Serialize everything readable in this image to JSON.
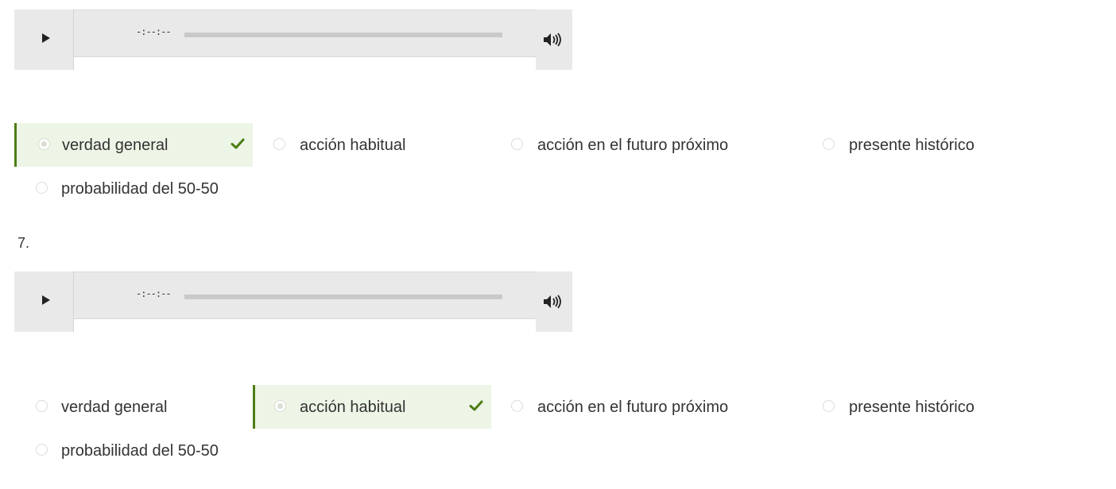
{
  "question_6": {
    "player": {
      "time": "-:--:--"
    },
    "options": [
      {
        "label": "verdad general"
      },
      {
        "label": "acción habitual"
      },
      {
        "label": "acción en el futuro próximo"
      },
      {
        "label": "presente histórico"
      },
      {
        "label": "probabilidad del 50-50"
      }
    ],
    "selected_option": "verdad general",
    "correct": true
  },
  "question_7": {
    "number": "7.",
    "player": {
      "time": "-:--:--"
    },
    "options": [
      {
        "label": "verdad general"
      },
      {
        "label": "acción habitual"
      },
      {
        "label": "acción en el futuro próximo"
      },
      {
        "label": "presente histórico"
      },
      {
        "label": "probabilidad del 50-50"
      }
    ],
    "selected_option": "acción habitual",
    "correct": true
  },
  "icons": {
    "play": "play-icon",
    "volume": "volume-icon",
    "correct": "checkmark-icon"
  },
  "colors": {
    "correct_accent": "#4c7d15",
    "correct_background": "#edf5e6",
    "player_background": "#e9e9e9",
    "progress_track": "#c9c9c9"
  }
}
